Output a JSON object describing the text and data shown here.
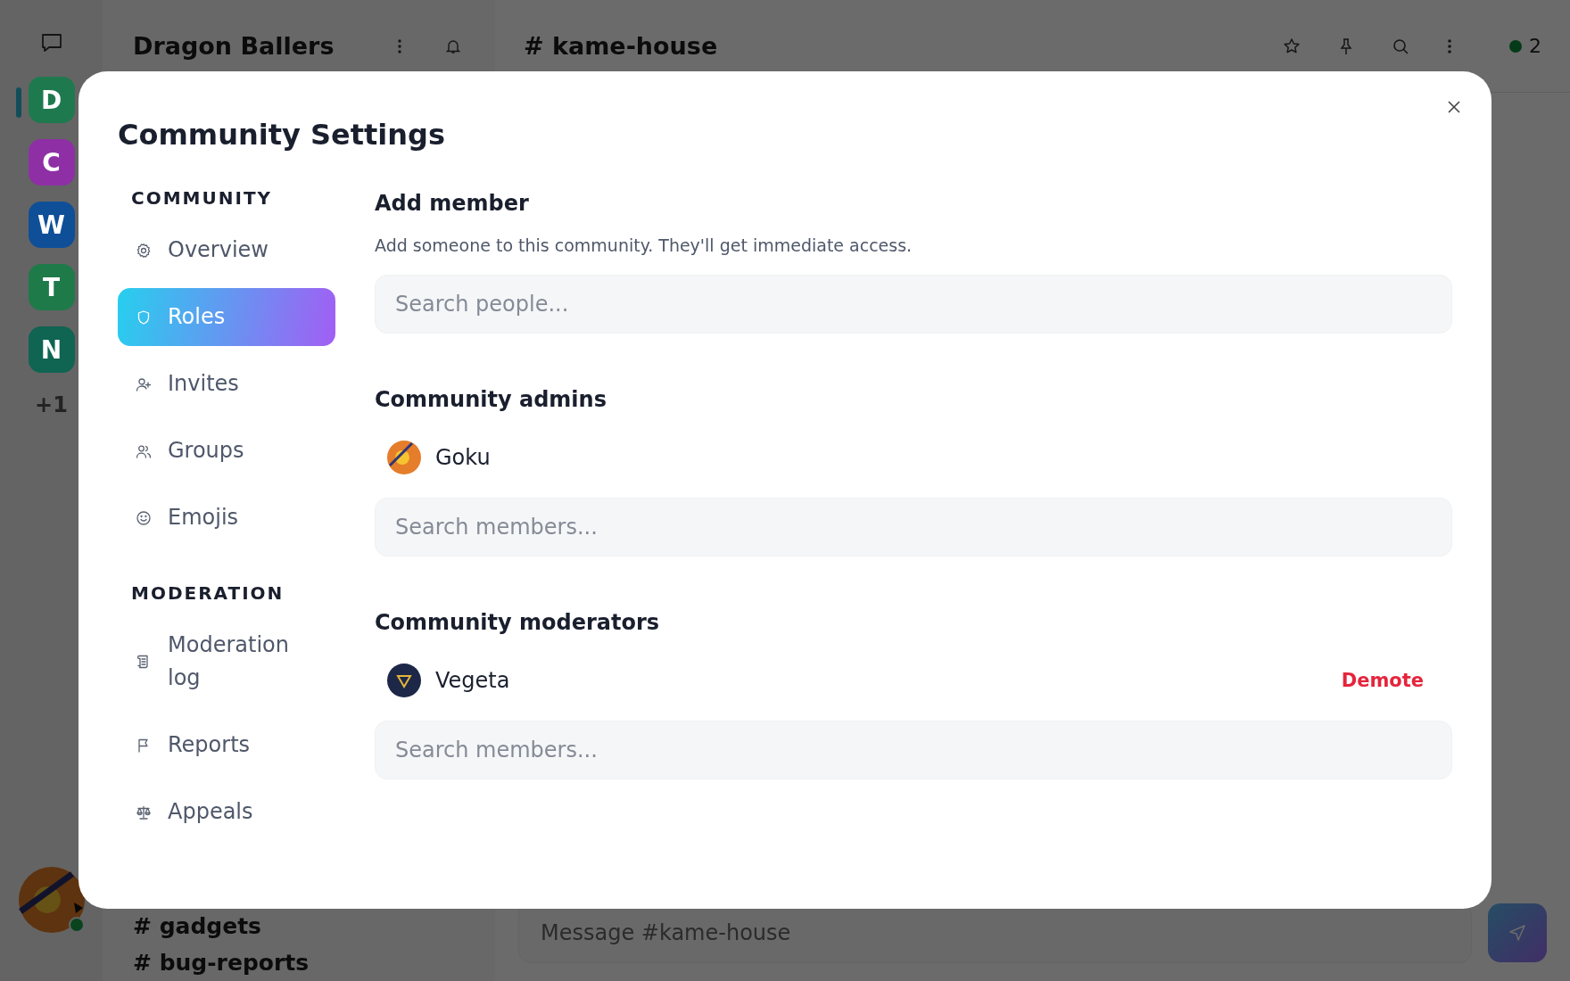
{
  "servers": {
    "items": [
      {
        "letter": "D",
        "color": "#1e7a4e",
        "selected": true
      },
      {
        "letter": "C",
        "color": "#8e2fa6",
        "selected": false
      },
      {
        "letter": "W",
        "color": "#0e4f98",
        "selected": false
      },
      {
        "letter": "T",
        "color": "#1f7a4a",
        "selected": false
      },
      {
        "letter": "N",
        "color": "#0f6452",
        "selected": false
      }
    ],
    "more": "+1"
  },
  "channel_sidebar": {
    "title": "Dragon Ballers",
    "channels": [
      "# gadgets",
      "# bug-reports"
    ]
  },
  "channel_header": {
    "title": "# kame-house",
    "online_count": "2"
  },
  "composer": {
    "placeholder": "Message #kame-house"
  },
  "modal": {
    "title": "Community Settings",
    "nav": [
      {
        "heading": "COMMUNITY",
        "items": [
          {
            "label": "Overview",
            "kind": "gear",
            "selected": false
          },
          {
            "label": "Roles",
            "kind": "shield",
            "selected": true
          },
          {
            "label": "Invites",
            "kind": "person-plus",
            "selected": false
          },
          {
            "label": "Groups",
            "kind": "people",
            "selected": false
          },
          {
            "label": "Emojis",
            "kind": "smile",
            "selected": false
          }
        ]
      },
      {
        "heading": "MODERATION",
        "items": [
          {
            "label": "Moderation log",
            "kind": "scroll",
            "selected": false
          },
          {
            "label": "Reports",
            "kind": "flag",
            "selected": false
          },
          {
            "label": "Appeals",
            "kind": "scales",
            "selected": false
          }
        ]
      }
    ],
    "sections": [
      {
        "title": "Add member",
        "description": "Add someone to this community. They'll get immediate access.",
        "search_placeholder": "Search people..."
      },
      {
        "title": "Community admins",
        "members": [
          {
            "name": "Goku",
            "kind": "sun"
          }
        ],
        "search_placeholder": "Search members..."
      },
      {
        "title": "Community moderators",
        "members": [
          {
            "name": "Vegeta",
            "kind": "triangle",
            "action": "Demote"
          }
        ],
        "search_placeholder": "Search members..."
      }
    ]
  }
}
